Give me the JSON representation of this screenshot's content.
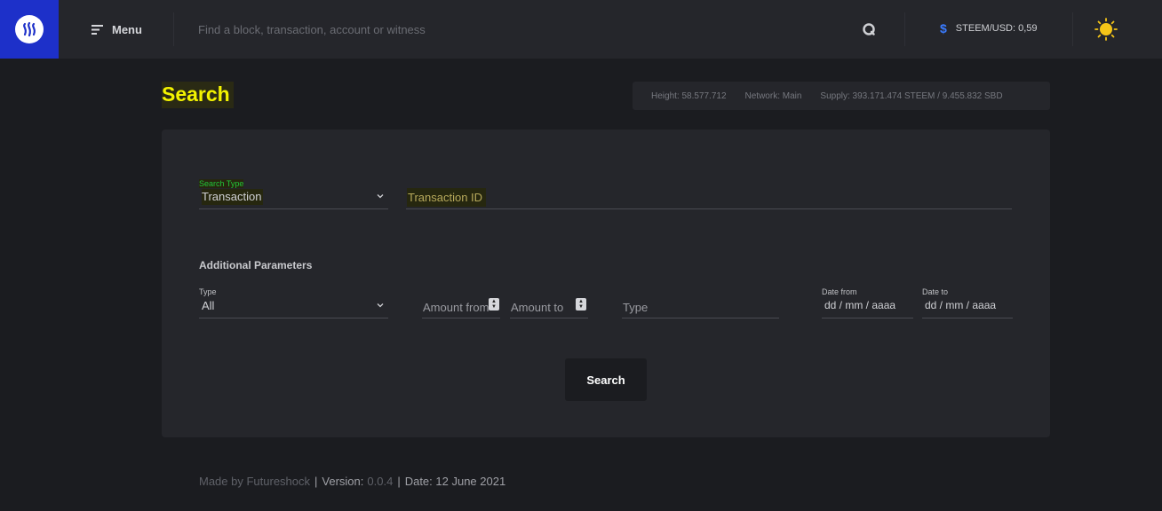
{
  "header": {
    "menu_label": "Menu",
    "search_placeholder": "Find a block, transaction, account or witness",
    "price_label": "STEEM/USD: 0,59",
    "icons": {
      "logo": "steem-logo-icon",
      "menu": "hamburger-icon",
      "search": "search-icon",
      "price": "dollar-icon",
      "theme": "sun-icon"
    },
    "colors": {
      "brand": "#1d30c9",
      "price_icon": "#3a7bff",
      "theme_icon": "#f5c518"
    }
  },
  "page": {
    "title": "Search",
    "stats": {
      "height": "Height: 58.577.712",
      "network": "Network: Main",
      "supply": "Supply: 393.171.474 STEEM / 9.455.832 SBD"
    }
  },
  "form": {
    "search_type": {
      "label": "Search Type",
      "value": "Transaction"
    },
    "transaction_id_placeholder": "Transaction ID",
    "additional_title": "Additional Parameters",
    "type_select": {
      "label": "Type",
      "value": "All"
    },
    "amount_from_placeholder": "Amount from",
    "amount_to_placeholder": "Amount to",
    "type_input_placeholder": "Type",
    "date_from": {
      "label": "Date from",
      "placeholder": "dd / mm / aaaa"
    },
    "date_to": {
      "label": "Date to",
      "placeholder": "dd / mm / aaaa"
    },
    "submit_label": "Search"
  },
  "footer": {
    "made_by": "Made by Futureshock",
    "version_label": "Version:",
    "version_value": "0.0.4",
    "date_text": "Date: 12 June 2021"
  }
}
